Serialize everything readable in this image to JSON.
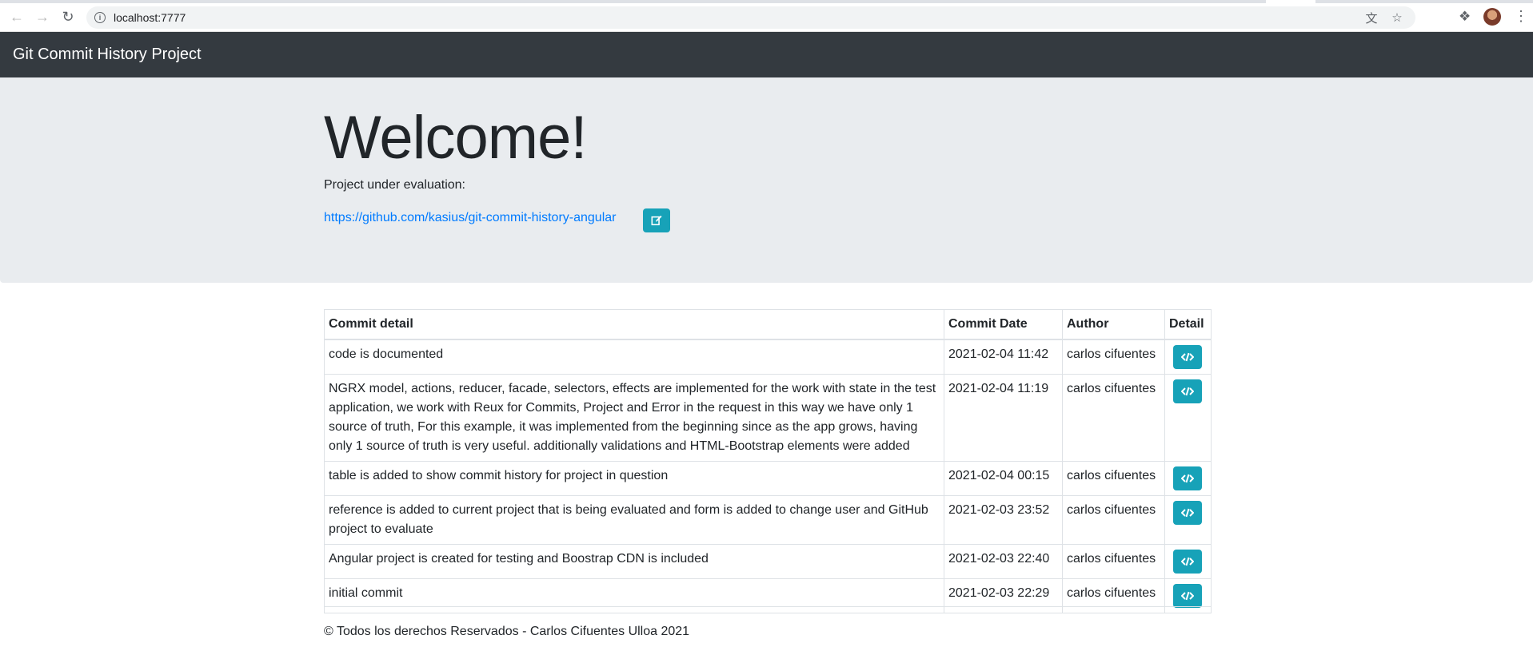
{
  "browser": {
    "url": "localhost:7777"
  },
  "navbar": {
    "brand": "Git Commit History Project"
  },
  "jumbotron": {
    "title": "Welcome!",
    "eval_label": "Project under evaluation:",
    "project_url": "https://github.com/kasius/git-commit-history-angular"
  },
  "table": {
    "headers": {
      "detail": "Commit detail",
      "date": "Commit Date",
      "author": "Author",
      "action": "Detail"
    },
    "rows": [
      {
        "message": "code is documented",
        "date": "2021-02-04 11:42",
        "author": "carlos cifuentes"
      },
      {
        "message": "NGRX model, actions, reducer, facade, selectors, effects are implemented for the work with state in the test application, we work with Reux for Commits, Project and Error in the request in this way we have only 1 source of truth, For this example, it was implemented from the beginning since as the app grows, having only 1 source of truth is very useful. additionally validations and HTML-Bootstrap elements were added",
        "date": "2021-02-04 11:19",
        "author": "carlos cifuentes"
      },
      {
        "message": "table is added to show commit history for project in question",
        "date": "2021-02-04 00:15",
        "author": "carlos cifuentes"
      },
      {
        "message": "reference is added to current project that is being evaluated and form is added to change user and GitHub project to evaluate",
        "date": "2021-02-03 23:52",
        "author": "carlos cifuentes"
      },
      {
        "message": "Angular project is created for testing and Boostrap CDN is included",
        "date": "2021-02-03 22:40",
        "author": "carlos cifuentes"
      },
      {
        "message": "initial commit",
        "date": "2021-02-03 22:29",
        "author": "carlos cifuentes"
      }
    ]
  },
  "footer": {
    "text": "© Todos los derechos Reservados - Carlos Cifuentes Ulloa 2021"
  },
  "colors": {
    "navbar": "#343a40",
    "jumbotron": "#e9ecef",
    "info_button": "#17a2b8",
    "link": "#007bff"
  }
}
